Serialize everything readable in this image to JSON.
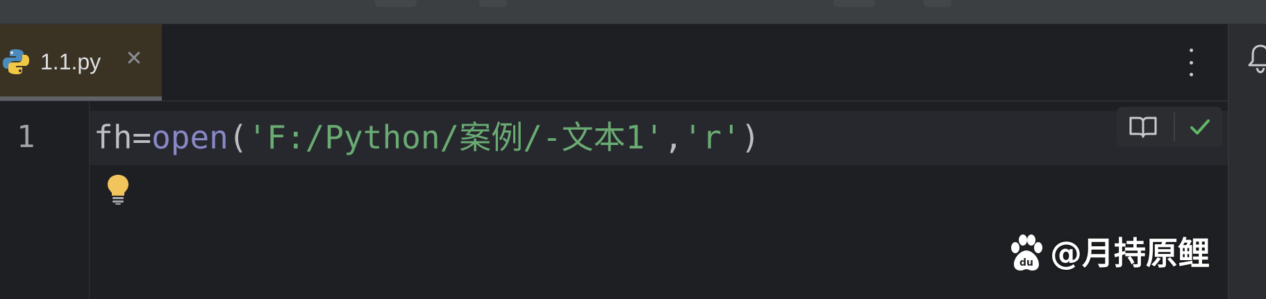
{
  "tab": {
    "file_name": "1.1.py",
    "close_glyph": "✕",
    "icon": "python-file-icon"
  },
  "editor": {
    "line_number": "1",
    "code": {
      "ident": "fh",
      "assign": "=",
      "builtin": "open",
      "open_paren": "(",
      "arg1": "'F:/Python/案例/-文本1'",
      "comma": ",",
      "arg2": "'r'",
      "close_paren": ")"
    },
    "icons": [
      "lightbulb-icon",
      "reader-mode-icon",
      "check-icon",
      "more-vertical-icon",
      "notifications-bell-icon"
    ]
  },
  "watermark": {
    "text": "@月持原鲤",
    "logo": "baidu-paw-icon"
  },
  "colors": {
    "background": "#1e1f22",
    "string": "#6aab73",
    "builtin": "#8888c6",
    "active_tab": "#3a3324",
    "check": "#5fb865"
  }
}
